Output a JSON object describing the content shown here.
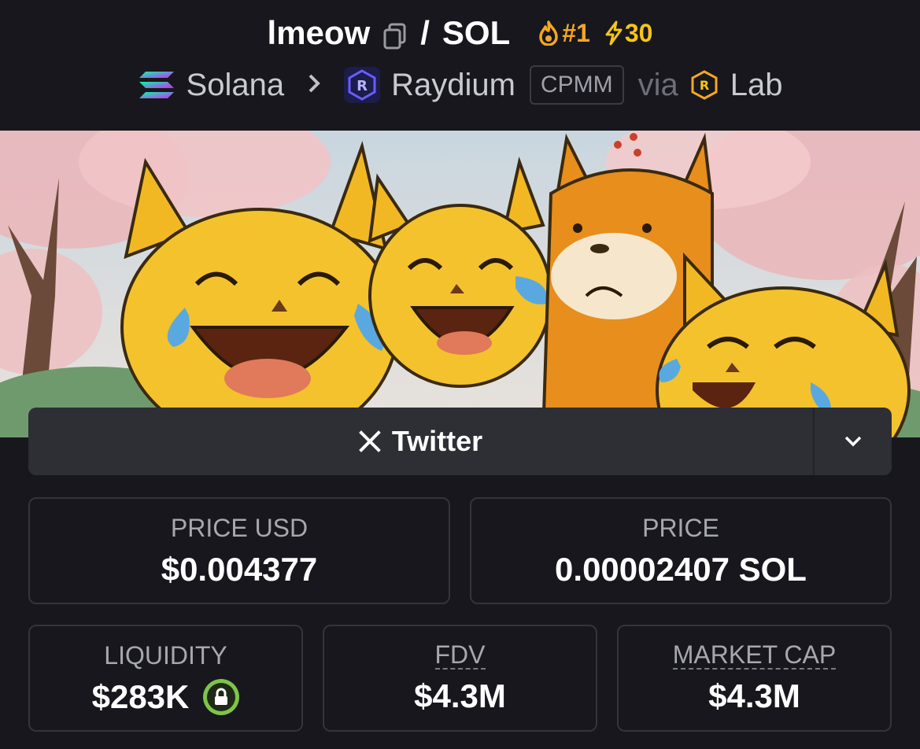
{
  "header": {
    "token": "lmeow",
    "separator": "/",
    "quote": "SOL",
    "rank": "#1",
    "boosts": "30",
    "chain": "Solana",
    "dex": "Raydium",
    "pool_type": "CPMM",
    "via": "via",
    "launchpad": "Lab"
  },
  "social": {
    "twitter_label": "Twitter"
  },
  "stats": {
    "price_usd_label": "PRICE USD",
    "price_usd": "$0.004377",
    "price_label": "PRICE",
    "price": "0.00002407 SOL",
    "liquidity_label": "LIQUIDITY",
    "liquidity": "$283K",
    "fdv_label": "FDV",
    "fdv": "$4.3M",
    "mcap_label": "MARKET CAP",
    "mcap": "$4.3M"
  },
  "colors": {
    "background": "#17171d",
    "rank_orange": "#f5a623",
    "boost_yellow": "#f5c518",
    "lock_green": "#7fc449"
  },
  "icons": [
    "copy-icon",
    "fire-icon",
    "lightning-icon",
    "solana-icon",
    "chevron-right-icon",
    "raydium-icon",
    "lab-icon",
    "x-logo-icon",
    "chevron-down-icon",
    "lock-icon"
  ]
}
